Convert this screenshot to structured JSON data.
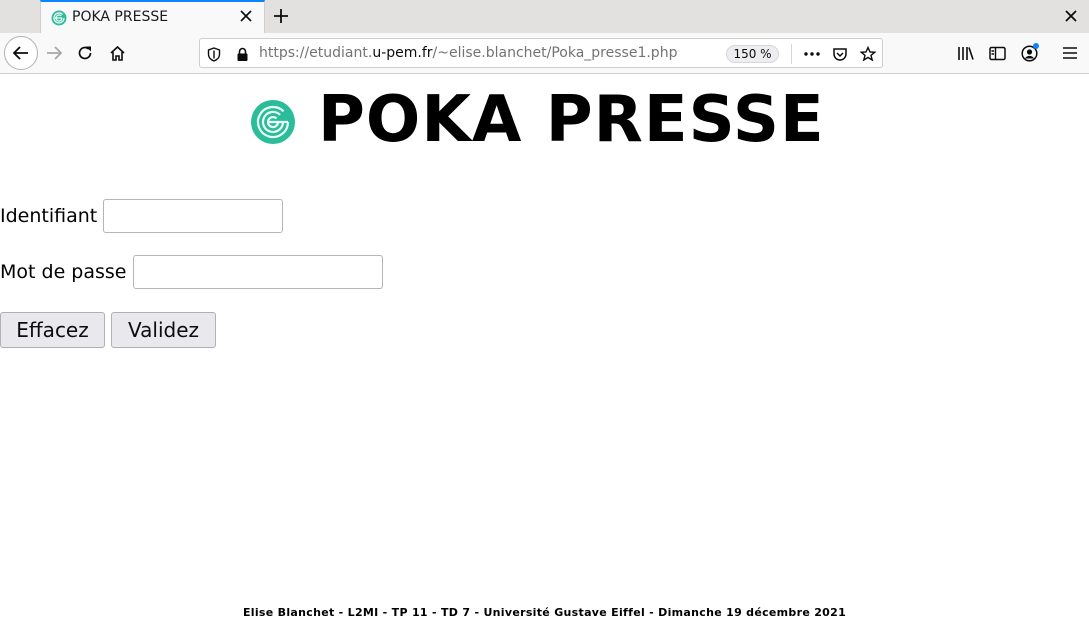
{
  "browser": {
    "tab": {
      "title": "POKA PRESSE"
    },
    "url": {
      "prefix": "https://etudiant.",
      "host": "u-pem.fr",
      "path": "/~elise.blanchet/Poka_presse1.php"
    },
    "zoom": "150 %",
    "icons": {
      "tab_close": "close-icon",
      "new_tab": "plus-icon",
      "window_close": "close-icon",
      "back": "arrow-left-icon",
      "forward": "arrow-right-icon",
      "reload": "reload-icon",
      "home": "home-icon",
      "tracking": "shield-icon",
      "lock": "lock-icon",
      "page_actions": "more-dots-icon",
      "pocket": "pocket-icon",
      "bookmark": "star-icon",
      "library": "library-icon",
      "sidebar": "sidebar-icon",
      "account": "account-icon",
      "menu": "hamburger-menu-icon"
    }
  },
  "page": {
    "brand": {
      "title": "POKA PRESSE",
      "logo_color": "#2bbd9a"
    },
    "form": {
      "username_label": "Identifiant",
      "username_value": "",
      "password_label": "Mot de passe",
      "password_value": "",
      "reset_label": "Effacez",
      "submit_label": "Validez"
    },
    "footer": "Elise Blanchet - L2MI - TP 11 - TD 7 - Université Gustave Eiffel - Dimanche 19 décembre 2021"
  }
}
